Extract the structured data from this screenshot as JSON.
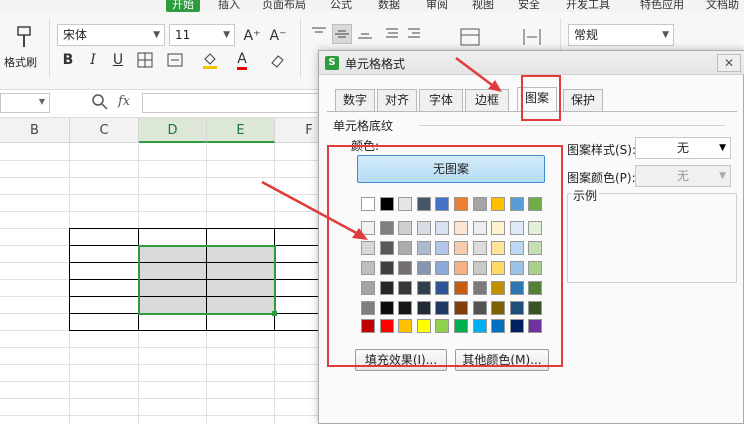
{
  "menu": {
    "items": [
      {
        "label": "开始",
        "active": true
      },
      {
        "label": "插入"
      },
      {
        "label": "页面布局"
      },
      {
        "label": "公式"
      },
      {
        "label": "数据"
      },
      {
        "label": "审阅"
      },
      {
        "label": "视图"
      },
      {
        "label": "安全"
      },
      {
        "label": "开发工具"
      },
      {
        "label": "特色应用"
      },
      {
        "label": "文档助"
      }
    ]
  },
  "ribbon": {
    "format_painter_label": "格式刷",
    "font_name": "宋体",
    "font_size": "11",
    "number_format": "常规",
    "bold": "B",
    "italic": "I",
    "underline": "U",
    "font_grow": "A⁺",
    "font_shrink": "A⁻",
    "font_color_letter": "A"
  },
  "formula_bar": {
    "fx": "fx"
  },
  "sheet": {
    "columns": [
      "B",
      "C",
      "D",
      "E",
      "F"
    ]
  },
  "dialog": {
    "title": "单元格格式",
    "tabs": [
      "数字",
      "对齐",
      "字体",
      "边框",
      "图案",
      "保护"
    ],
    "active_tab": "图案",
    "section_label": "单元格底纹",
    "color_label": "颜色:",
    "no_pattern_button": "无图案",
    "pattern_style_label": "图案样式(S):",
    "pattern_style_value": "无",
    "pattern_color_label": "图案颜色(P):",
    "pattern_color_value": "无",
    "sample_label": "示例",
    "fill_effects_button": "填充效果(I)...",
    "more_colors_button": "其他颜色(M)...",
    "palette_rows": [
      [
        "#ffffff",
        "#000000",
        "#e7e6e6",
        "#44546a",
        "#4472c4",
        "#ed7d31",
        "#a5a5a5",
        "#ffc000",
        "#5b9bd5",
        "#70ad47"
      ],
      [
        "#f2f2f2",
        "#7f7f7f",
        "#d0cece",
        "#d6dce4",
        "#d9e2f3",
        "#fbe5d5",
        "#ededed",
        "#fff2cc",
        "#deebf6",
        "#e2efd9"
      ],
      [
        "#d8d8d8",
        "#595959",
        "#aeaaaa",
        "#adb9ca",
        "#b4c6e7",
        "#f7cbac",
        "#dbdbdb",
        "#fee599",
        "#bdd7ee",
        "#c5e0b3"
      ],
      [
        "#bfbfbf",
        "#3f3f3f",
        "#757070",
        "#8496b0",
        "#8eaadb",
        "#f4b183",
        "#c9c9c9",
        "#ffd965",
        "#9cc3e5",
        "#a8d08d"
      ],
      [
        "#a5a5a5",
        "#262626",
        "#3a3838",
        "#323f4f",
        "#2f5496",
        "#c55a11",
        "#7b7b7b",
        "#bf9000",
        "#2e75b5",
        "#538135"
      ],
      [
        "#7f7f7f",
        "#0c0c0c",
        "#171616",
        "#222a35",
        "#1f3864",
        "#833c0b",
        "#525252",
        "#7f6000",
        "#1e4e79",
        "#375623"
      ]
    ],
    "standard_colors": [
      "#c00000",
      "#ff0000",
      "#ffc000",
      "#ffff00",
      "#92d050",
      "#00b050",
      "#00b0f0",
      "#0070c0",
      "#002060",
      "#7030a0"
    ],
    "accent_color": "#2e9b3e"
  }
}
